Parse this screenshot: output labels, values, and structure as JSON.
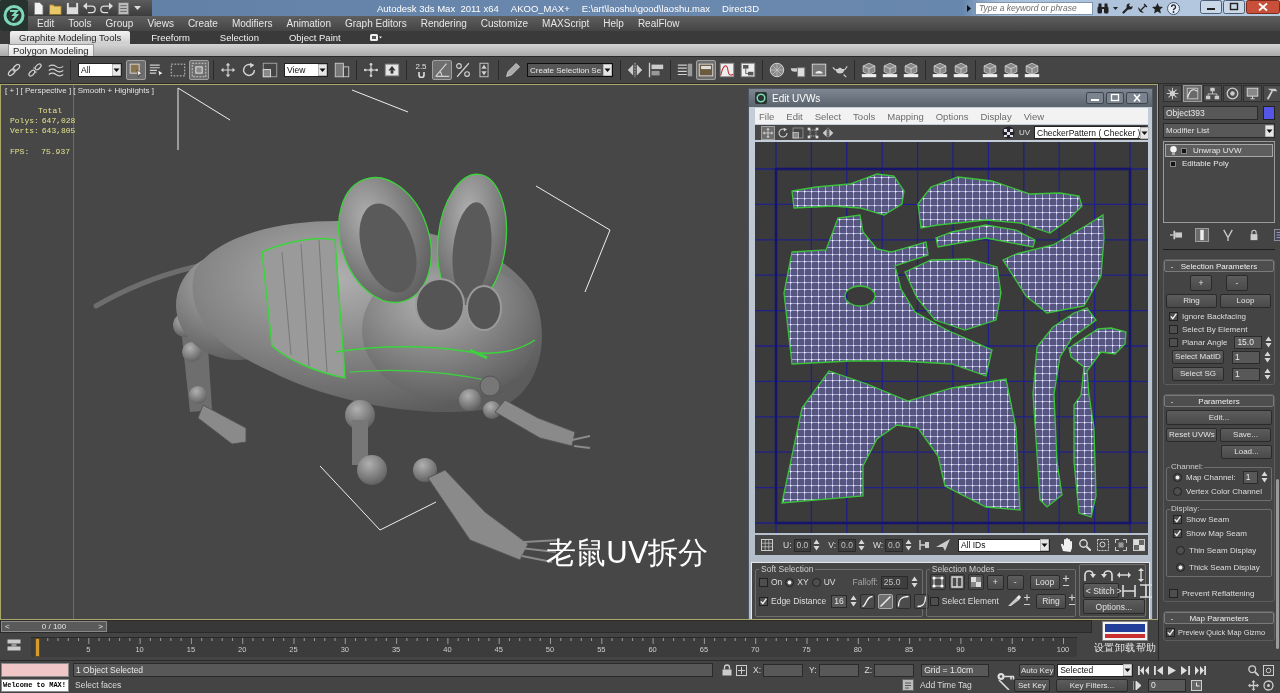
{
  "title_bar": {
    "app": "Autodesk 3ds Max  2011 x64",
    "project": "AKOO_MAX+",
    "file": "E:\\art\\laoshu\\good\\laoshu.max",
    "renderer": "Direct3D",
    "search": {
      "placeholder": "Type a keyword or phrase"
    }
  },
  "menu_bar": [
    "Edit",
    "Tools",
    "Group",
    "Views",
    "Create",
    "Modifiers",
    "Animation",
    "Graph Editors",
    "Rendering",
    "Customize",
    "MAXScript",
    "Help",
    "RealFlow"
  ],
  "ribbon": {
    "tabs": [
      {
        "label": "Graphite Modeling Tools",
        "selected": true
      },
      {
        "label": "Freeform",
        "selected": false
      },
      {
        "label": "Selection",
        "selected": false
      },
      {
        "label": "Object Paint",
        "selected": false
      }
    ],
    "panels": [
      {
        "label": "Polygon Modeling",
        "selected": true
      }
    ]
  },
  "main_toolbar": {
    "groups": [
      [
        {
          "kind": "link",
          "pressed": false
        },
        {
          "kind": "unlink",
          "pressed": false
        },
        {
          "kind": "bind",
          "pressed": false
        }
      ],
      [
        {
          "kind": "filter-dropdown",
          "value": "All"
        },
        {
          "kind": "select",
          "pressed": true
        },
        {
          "kind": "select-by-name",
          "pressed": false
        },
        {
          "kind": "region",
          "pressed": false
        },
        {
          "kind": "crossing",
          "pressed": true
        }
      ],
      [
        {
          "kind": "move",
          "pressed": false
        },
        {
          "kind": "rotate",
          "pressed": false
        },
        {
          "kind": "scale",
          "pressed": false
        },
        {
          "kind": "coordinate-dropdown",
          "value": "View"
        },
        {
          "kind": "pivot",
          "pressed": false
        }
      ],
      [
        {
          "kind": "manipulate",
          "pressed": false
        },
        {
          "kind": "keyboard",
          "pressed": false
        }
      ],
      [
        {
          "kind": "snap",
          "label": "2.5",
          "pressed": false
        },
        {
          "kind": "angle",
          "pressed": true
        },
        {
          "kind": "percent",
          "pressed": false
        },
        {
          "kind": "spinner",
          "pressed": false
        }
      ],
      [
        {
          "kind": "named-edit",
          "pressed": false
        },
        {
          "kind": "selection-set-dropdown",
          "value": "Create Selection Se"
        }
      ],
      [
        {
          "kind": "mirror",
          "pressed": false
        },
        {
          "kind": "align",
          "pressed": false
        }
      ],
      [
        {
          "kind": "layers",
          "pressed": false
        },
        {
          "kind": "graphite",
          "pressed": true
        },
        {
          "kind": "curve",
          "pressed": false
        },
        {
          "kind": "schematic",
          "pressed": false
        }
      ],
      [
        {
          "kind": "material",
          "pressed": false
        },
        {
          "kind": "render-setup",
          "pressed": false
        },
        {
          "kind": "render-frame",
          "pressed": false
        },
        {
          "kind": "render",
          "pressed": false
        }
      ],
      [
        {
          "kind": "cube",
          "pressed": false
        },
        {
          "kind": "cube",
          "pressed": false
        },
        {
          "kind": "cube",
          "pressed": false
        }
      ],
      [
        {
          "kind": "cube",
          "pressed": false
        },
        {
          "kind": "cube",
          "pressed": false
        }
      ],
      [
        {
          "kind": "cube",
          "pressed": false
        },
        {
          "kind": "cube",
          "pressed": false
        },
        {
          "kind": "cube",
          "pressed": false
        }
      ]
    ]
  },
  "viewport": {
    "labels": [
      "[ + ]",
      "[ Perspective ]",
      "[ Smooth + Highlights ]"
    ],
    "statistics": {
      "heading": "Total",
      "rows": [
        {
          "label": "Polys:",
          "value": "647,028"
        },
        {
          "label": "Verts:",
          "value": "643,805"
        },
        {
          "label": "FPS:",
          "value": "75.937"
        }
      ]
    },
    "caption": "老鼠UV拆分"
  },
  "uv_editor": {
    "title": "Edit UVWs",
    "menu": [
      "File",
      "Edit",
      "Select",
      "Tools",
      "Mapping",
      "Options",
      "Display",
      "View"
    ],
    "tools": [
      {
        "kind": "move",
        "pressed": true
      },
      {
        "kind": "rotate",
        "pressed": false
      },
      {
        "kind": "scale",
        "pressed": false
      },
      {
        "kind": "freeform",
        "pressed": false
      },
      {
        "kind": "mirror",
        "pressed": false
      }
    ],
    "channel_label": "UV",
    "texture": "CheckerPattern ( Checker )",
    "coords": [
      {
        "label": "U:",
        "value": "0.0",
        "disabled": true
      },
      {
        "label": "V:",
        "value": "0.0",
        "disabled": true
      },
      {
        "label": "W:",
        "value": "0.0",
        "disabled": true
      }
    ],
    "id_filter": "All IDs",
    "soft_selection": {
      "title": "Soft Selection",
      "on": {
        "label": "On",
        "checked": false
      },
      "space": [
        {
          "label": "XY",
          "selected": true
        },
        {
          "label": "UV",
          "selected": false
        }
      ],
      "falloff": {
        "label": "Falloff:",
        "value": "25.0",
        "disabled": true
      },
      "edge_distance": {
        "label": "Edge Distance",
        "checked": true,
        "value": "16"
      },
      "curves": [
        {
          "kind": "smooth",
          "selected": false
        },
        {
          "kind": "linear",
          "selected": true
        },
        {
          "kind": "slow-out",
          "selected": false
        },
        {
          "kind": "fast-out",
          "selected": false
        }
      ]
    },
    "selection_modes": {
      "title": "Selection Modes",
      "modes": [
        {
          "kind": "vertex"
        },
        {
          "kind": "edge"
        },
        {
          "kind": "face"
        }
      ],
      "grow": "+",
      "shrink": "-",
      "loop": "Loop",
      "ring": "Ring",
      "select_element": {
        "label": "Select Element",
        "checked": false
      }
    },
    "stitch": "< Stitch >",
    "options": "Options..."
  },
  "command_panel": {
    "tabs": [
      {
        "kind": "create",
        "selected": false
      },
      {
        "kind": "modify",
        "selected": true
      },
      {
        "kind": "hierarchy",
        "selected": false
      },
      {
        "kind": "motion",
        "selected": false
      },
      {
        "kind": "display",
        "selected": false
      },
      {
        "kind": "utilities",
        "selected": false
      }
    ],
    "object_name": "Object393",
    "modifier_list": "Modifier List",
    "stack": [
      {
        "label": "Unwrap UVW",
        "kind": "modifier",
        "selected": true
      },
      {
        "label": "Editable Poly",
        "kind": "object",
        "selected": false
      }
    ],
    "stack_tools": [
      {
        "kind": "pin",
        "pressed": false
      },
      {
        "kind": "end-result",
        "pressed": true
      },
      {
        "kind": "unique",
        "pressed": false
      },
      {
        "kind": "remove",
        "pressed": false
      },
      {
        "kind": "configure",
        "pressed": false
      }
    ],
    "selection_parameters": {
      "toggle": "-",
      "title": "Selection Parameters",
      "grow": "+",
      "shrink": "-",
      "ring": "Ring",
      "loop": "Loop",
      "options": [
        {
          "label": "Ignore Backfacing",
          "checked": true
        },
        {
          "label": "Select By Element",
          "checked": false
        },
        {
          "label": "Planar Angle",
          "checked": false,
          "value": "15.0"
        }
      ],
      "matid": {
        "label": "Select MatID",
        "value": "1"
      },
      "smoothing": {
        "label": "Select SG",
        "value": "1"
      }
    },
    "parameters": {
      "toggle": "-",
      "title": "Parameters",
      "edit": "Edit...",
      "reset": "Reset UVWs",
      "save": "Save...",
      "load": "Load...",
      "channel": {
        "title": "Channel:",
        "options": [
          {
            "label": "Map Channel:",
            "selected": true,
            "value": "1"
          },
          {
            "label": "Vertex Color Channel",
            "selected": false
          }
        ]
      },
      "display": {
        "title": "Display:",
        "checks": [
          {
            "label": "Show Seam",
            "checked": true
          },
          {
            "label": "Show Map Seam",
            "checked": true
          }
        ],
        "seams": [
          {
            "label": "Thin Seam Display",
            "selected": false
          },
          {
            "label": "Thick Seam Display",
            "selected": true
          }
        ]
      },
      "prevent_reflattening": {
        "label": "Prevent Reflattening",
        "checked": false
      }
    },
    "map_parameters": {
      "toggle": "-",
      "title": "Map Parameters",
      "preview": {
        "label": "Preview Quick Map Gizmo",
        "checked": true
      }
    }
  },
  "timeline": {
    "slider": {
      "prev": "<",
      "label": "0 / 100",
      "next": ">",
      "level": 0
    },
    "ticks": [
      "5",
      "10",
      "15",
      "20",
      "25",
      "30",
      "35",
      "40",
      "45",
      "50",
      "55",
      "60",
      "65",
      "70",
      "75",
      "80",
      "85",
      "90",
      "95",
      "100"
    ],
    "plugin": {
      "links": [
        "设置",
        "卸载",
        "帮助"
      ]
    }
  },
  "status_bar": {
    "listener_output": "Welcome to MAX!",
    "selection_info": "1 Object Selected",
    "prompt": "Select faces",
    "coords": [
      "X:",
      "Y:",
      "Z:"
    ],
    "grid": "Grid = 1.0cm",
    "time_tag": "Add Time Tag",
    "auto_key": "Auto Key",
    "key_mode": "Selected",
    "set_key": "Set Key",
    "key_filters": "Key Filters...",
    "frame": "0"
  }
}
